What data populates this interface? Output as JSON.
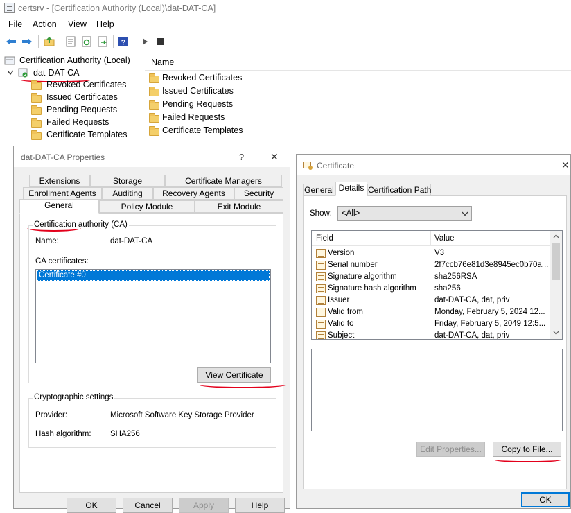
{
  "window": {
    "title": "certsrv - [Certification Authority (Local)\\dat-DAT-CA]"
  },
  "menu": [
    "File",
    "Action",
    "View",
    "Help"
  ],
  "tree": {
    "root": "Certification Authority (Local)",
    "ca": "dat-DAT-CA",
    "children": [
      "Revoked Certificates",
      "Issued Certificates",
      "Pending Requests",
      "Failed Requests",
      "Certificate Templates"
    ]
  },
  "list": {
    "header": "Name",
    "items": [
      "Revoked Certificates",
      "Issued Certificates",
      "Pending Requests",
      "Failed Requests",
      "Certificate Templates"
    ]
  },
  "props": {
    "title": "dat-DAT-CA Properties",
    "help_glyph": "?",
    "close_glyph": "✕",
    "tabs_row1": [
      "Extensions",
      "Storage",
      "Certificate Managers"
    ],
    "tabs_row2": [
      "Enrollment Agents",
      "Auditing",
      "Recovery Agents",
      "Security"
    ],
    "tabs_row3": [
      "General",
      "Policy Module",
      "Exit Module"
    ],
    "ca_group": "Certification authority (CA)",
    "name_label": "Name:",
    "name_value": "dat-DAT-CA",
    "ca_certs_label": "CA certificates:",
    "cert_item": "Certificate #0",
    "view_cert_button": "View Certificate",
    "crypto_group": "Cryptographic settings",
    "provider_label": "Provider:",
    "provider_value": "Microsoft Software Key Storage Provider",
    "hash_label": "Hash algorithm:",
    "hash_value": "SHA256",
    "buttons": {
      "ok": "OK",
      "cancel": "Cancel",
      "apply": "Apply",
      "help": "Help"
    }
  },
  "cert": {
    "title": "Certificate",
    "close_glyph": "✕",
    "tabs": [
      "General",
      "Details",
      "Certification Path"
    ],
    "show_label": "Show:",
    "show_value": "<All>",
    "columns": [
      "Field",
      "Value"
    ],
    "rows": [
      {
        "field": "Version",
        "value": "V3"
      },
      {
        "field": "Serial number",
        "value": "2f7ccb76e81d3e8945ec0b70a..."
      },
      {
        "field": "Signature algorithm",
        "value": "sha256RSA"
      },
      {
        "field": "Signature hash algorithm",
        "value": "sha256"
      },
      {
        "field": "Issuer",
        "value": "dat-DAT-CA, dat, priv"
      },
      {
        "field": "Valid from",
        "value": "Monday, February 5, 2024 12..."
      },
      {
        "field": "Valid to",
        "value": "Friday, February 5, 2049 12:5..."
      },
      {
        "field": "Subject",
        "value": "dat-DAT-CA, dat, priv"
      }
    ],
    "edit_props_button": "Edit Properties...",
    "copy_button": "Copy to File...",
    "ok_button": "OK"
  },
  "colors": {
    "selection": "#0078d7",
    "annotation": "#e3001b",
    "folder": "#f4cf6a"
  }
}
